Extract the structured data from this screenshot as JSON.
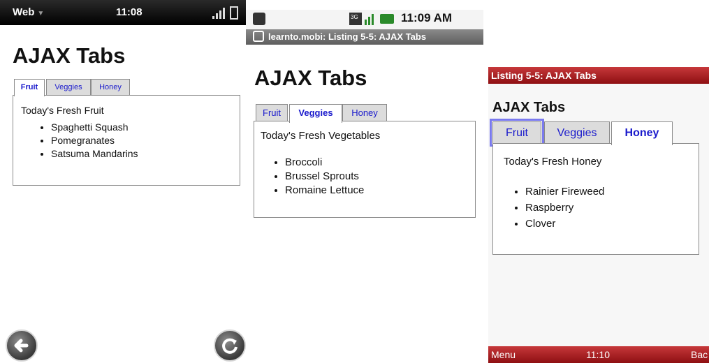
{
  "panel1": {
    "status": {
      "app_label": "Web",
      "time": "11:08"
    },
    "page_title": "AJAX Tabs",
    "tabs": [
      {
        "label": "Fruit",
        "active": true
      },
      {
        "label": "Veggies",
        "active": false
      },
      {
        "label": "Honey",
        "active": false
      }
    ],
    "content": {
      "heading": "Today's Fresh Fruit",
      "items": [
        "Spaghetti Squash",
        "Pomegranates",
        "Satsuma Mandarins"
      ]
    },
    "icons": [
      "back-icon",
      "reload-icon",
      "signal-icon",
      "battery-icon"
    ]
  },
  "panel2": {
    "status": {
      "time": "11:09 AM"
    },
    "title_bar": "learnto.mobi: Listing 5-5: AJAX Tabs",
    "page_title": "AJAX Tabs",
    "tabs": [
      {
        "label": "Fruit",
        "active": false
      },
      {
        "label": "Veggies",
        "active": true
      },
      {
        "label": "Honey",
        "active": false
      }
    ],
    "content": {
      "heading": "Today's Fresh Vegetables",
      "items": [
        "Broccoli",
        "Brussel Sprouts",
        "Romaine Lettuce"
      ]
    }
  },
  "panel3": {
    "title_bar": "Listing 5-5: AJAX Tabs",
    "page_title": "AJAX Tabs",
    "tabs": [
      {
        "label": "Fruit",
        "active": false,
        "focused": true
      },
      {
        "label": "Veggies",
        "active": false
      },
      {
        "label": "Honey",
        "active": true
      }
    ],
    "content": {
      "heading": "Today's Fresh Honey",
      "items": [
        "Rainier Fireweed",
        "Raspberry",
        "Clover"
      ]
    },
    "bottom_bar": {
      "menu_label": "Menu",
      "time": "11:10",
      "back_label": "Bac"
    }
  },
  "colors": {
    "tab_link": "#1a1acc",
    "tab_inactive_bg": "#dcdcdc",
    "bb_red": "#a81a1d",
    "border": "#8a8a8a"
  }
}
